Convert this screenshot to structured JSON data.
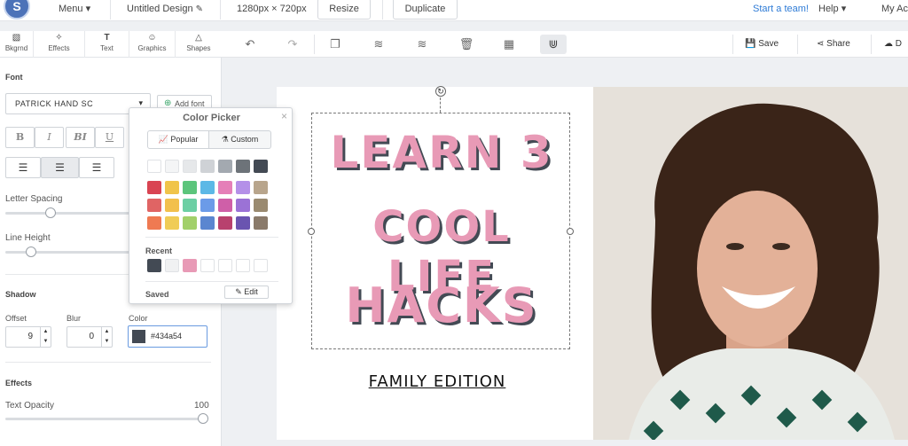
{
  "topbar": {
    "avatar_letter": "S",
    "menu_label": "Menu",
    "design_title": "Untitled Design",
    "dimensions": "1280px × 720px",
    "resize_label": "Resize",
    "duplicate_label": "Duplicate",
    "team_link": "Start a team!",
    "help_label": "Help",
    "account_label": "My Ac"
  },
  "tooltabs": [
    {
      "icon": "▧",
      "label": "Bkgrnd"
    },
    {
      "icon": "✧",
      "label": "Effects"
    },
    {
      "icon": "T",
      "label": "Text"
    },
    {
      "icon": "☺",
      "label": "Graphics"
    },
    {
      "icon": "△",
      "label": "Shapes"
    }
  ],
  "toolbar": {
    "save_label": "Save",
    "share_label": "Share",
    "download_label": "D"
  },
  "panel": {
    "font_section": "Font",
    "font_name": "Patrick Hand SC",
    "add_font": "Add font",
    "style_buttons": [
      "B",
      "I",
      "BI",
      "U"
    ],
    "letter_spacing": "Letter Spacing",
    "line_height": "Line Height",
    "letter_spacing_level": 0.35,
    "line_height_level": 0.18,
    "shadow_section": "Shadow",
    "offset_label": "Offset",
    "blur_label": "Blur",
    "color_label": "Color",
    "offset_value": "9",
    "blur_value": "0",
    "shadow_color": "#434a54",
    "effects_section": "Effects",
    "text_opacity_label": "Text Opacity",
    "text_opacity_value": "100"
  },
  "picker": {
    "title": "Color Picker",
    "tab_popular": "Popular",
    "tab_custom": "Custom",
    "recent_label": "Recent",
    "saved_label": "Saved",
    "edit_label": "Edit",
    "row1": [
      "#ffffff",
      "#f4f5f6",
      "#e6e8ea",
      "#cfd2d6",
      "#a3a9b0",
      "#6d7379",
      "#434a54"
    ],
    "row2": [
      "#d94452",
      "#f0c44a",
      "#5cc57c",
      "#5cb8e6",
      "#e57fb8",
      "#b490e8",
      "#b8a58c"
    ],
    "row3": [
      "#e06464",
      "#f2c04c",
      "#6ccfa4",
      "#6b9be8",
      "#cf5fa8",
      "#9b72d6",
      "#9a8a70"
    ],
    "row4": [
      "#ef7a52",
      "#f0cc56",
      "#a2d06a",
      "#5a86d0",
      "#b8416e",
      "#6a54b0",
      "#8a7a6a"
    ],
    "recent": [
      "#434a54",
      "#f0f1f2",
      "#e89ab6",
      "#ffffff",
      "#ffffff",
      "#ffffff",
      "#ffffff"
    ]
  },
  "canvas": {
    "headline_line1": "LEARN 3",
    "headline_line2": "COOL LIFE",
    "headline_line3": "HACKS",
    "subtitle": "FAMILY EDITION",
    "text_color": "#e89ab6",
    "shadow_color": "#434a54"
  }
}
